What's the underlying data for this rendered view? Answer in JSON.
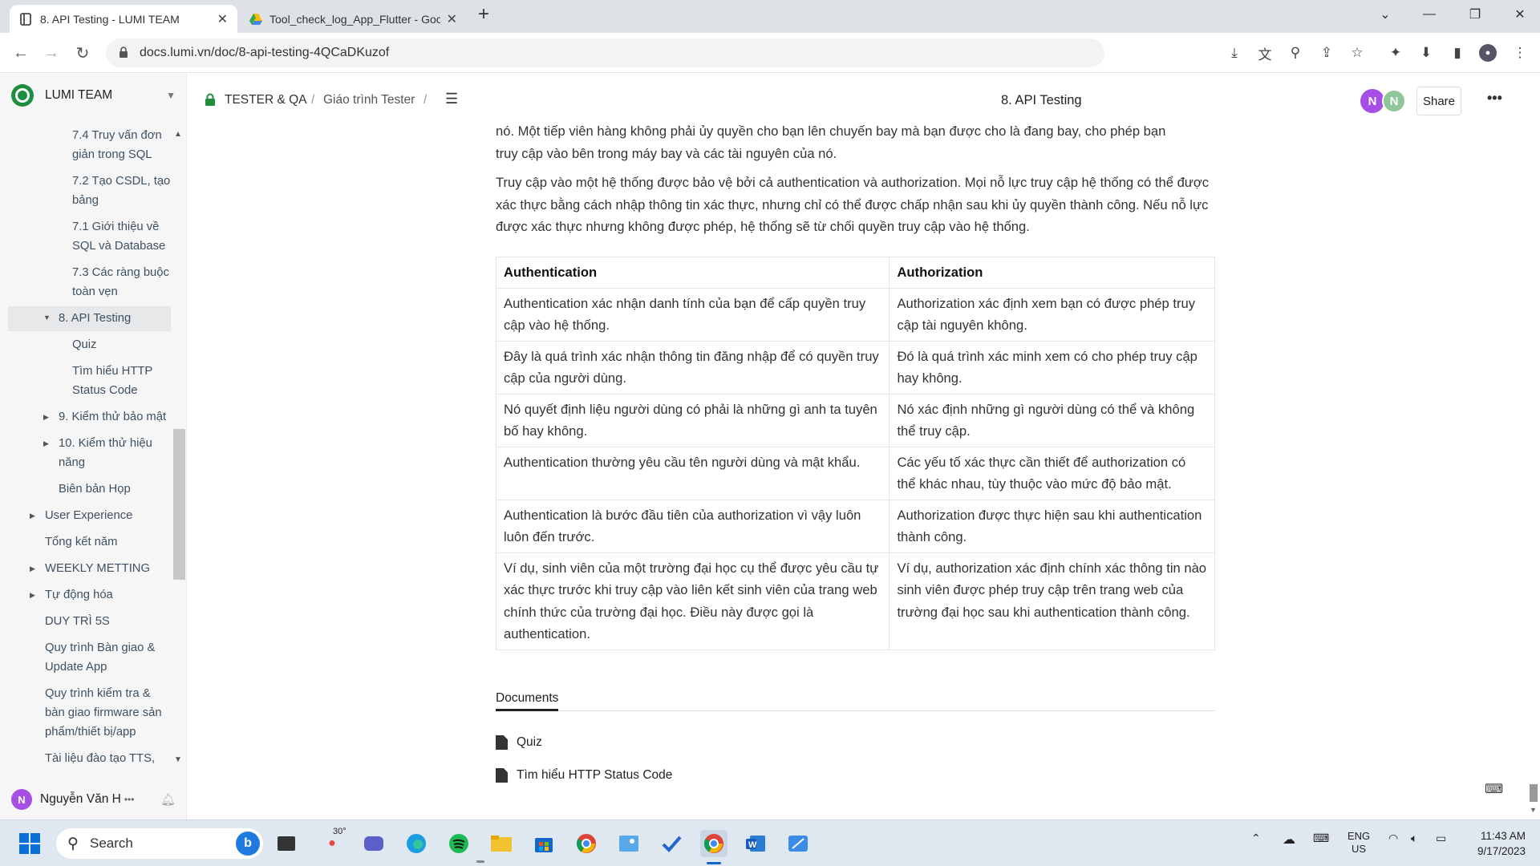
{
  "browser": {
    "tabs": [
      {
        "title": "8. API Testing - LUMI TEAM",
        "active": true
      },
      {
        "title": "Tool_check_log_App_Flutter - Goo",
        "active": false
      }
    ],
    "new_tab": "+",
    "url": "docs.lumi.vn/doc/8-api-testing-4QCaDKuzof"
  },
  "sidebar": {
    "workspace": "LUMI TEAM",
    "items": [
      "7.4 Truy vấn đơn",
      "giản trong SQL",
      "7.2 Tạo CSDL, tạo",
      "bảng",
      "7.1 Giới thiệu về",
      "SQL và Database",
      "7.3 Các ràng buộc",
      "toàn vẹn",
      "8. API Testing",
      "Quiz",
      "Tìm hiểu HTTP",
      "Status Code",
      "9. Kiểm thử bảo mật",
      "10. Kiểm thử hiệu",
      "năng",
      "Biên bản Họp",
      "User Experience",
      "Tổng kết năm",
      "WEEKLY METTING",
      "Tự động hóa",
      "DUY TRÌ 5S",
      "Quy trình Bàn giao &",
      "Update App",
      "Quy trình kiểm tra &",
      "bàn giao firmware sản",
      "phẩm/thiết bị/app",
      "Tài liệu đào tạo TTS,"
    ],
    "user": "Nguyễn Văn H",
    "user_initial": "N",
    "user_more": "•••"
  },
  "header": {
    "breadcrumb": [
      "TESTER & QA",
      "/",
      "Giáo trình Tester",
      "/"
    ],
    "title": "8. API Testing",
    "avatars": [
      "N",
      "N"
    ],
    "share": "Share",
    "more": "•••"
  },
  "content": {
    "para0_line1": "nó. Một tiếp viên hàng không phải ủy quyền cho bạn lên chuyến bay mà bạn được cho là đang bay, cho phép bạn",
    "para0_line2": "truy cập vào bên trong máy bay và các tài nguyên của nó.",
    "para1": "Truy cập vào một hệ thống được bảo vệ bởi cả authentication và authorization. Mọi nỗ lực truy cập hệ thống có thể được xác thực bằng cách nhập thông tin xác thực, nhưng chỉ có thể được chấp nhận sau khi ủy quyền thành công. Nếu nỗ lực được xác thực nhưng không được phép, hệ thống sẽ từ chối quyền truy cập vào hệ thống.",
    "table": {
      "headers": [
        "Authentication",
        "Authorization"
      ],
      "rows": [
        [
          "Authentication xác nhận danh tính của bạn để cấp quyền truy cập vào hệ thống.",
          "Authorization xác định xem bạn có được phép truy cập tài nguyên không."
        ],
        [
          "Đây là quá trình xác nhận thông tin đăng nhập để có quyền truy cập của người dùng.",
          "Đó là quá trình xác minh xem có cho phép truy cập hay không."
        ],
        [
          "Nó quyết định liệu người dùng có phải là những gì anh ta tuyên bố hay không.",
          "Nó xác định những gì người dùng có thể và không thể truy cập."
        ],
        [
          "Authentication thường yêu cầu tên người dùng và mật khẩu.",
          "Các yếu tố xác thực cần thiết để authorization có thể khác nhau, tùy thuộc vào mức độ bảo mật."
        ],
        [
          "Authentication là bước đầu tiên của authorization vì vậy luôn luôn đến trước.",
          "Authorization được thực hiện sau khi authentication thành công."
        ],
        [
          "Ví dụ, sinh viên của một trường đại học cụ thể được yêu cầu tự xác thực trước khi truy cập vào liên kết sinh viên của trang web chính thức của trường đại học. Điều này được gọi là authentication.",
          "Ví dụ, authorization xác định chính xác thông tin nào sinh viên được phép truy cập trên trang web của trường đại học sau khi authentication thành công."
        ]
      ]
    },
    "documents_tab": "Documents",
    "documents": [
      "Quiz",
      "Tìm hiểu HTTP Status Code"
    ]
  },
  "taskbar": {
    "search": "Search",
    "weather": "30°",
    "lang1": "ENG",
    "lang2": "US",
    "time": "11:43 AM",
    "date": "9/17/2023"
  }
}
